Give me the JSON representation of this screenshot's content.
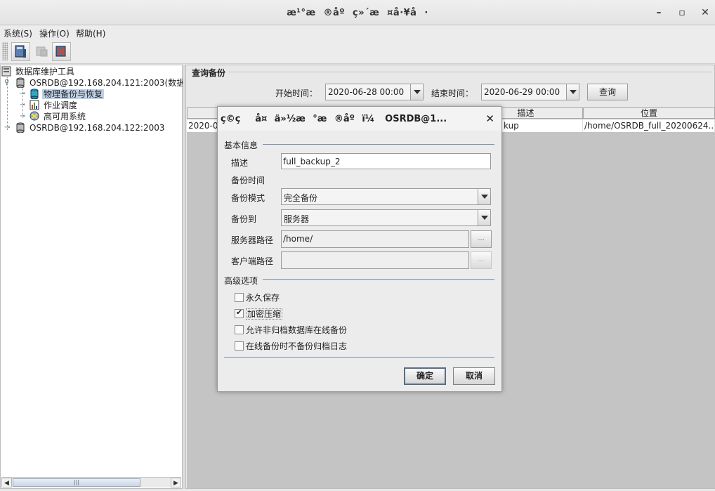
{
  "window": {
    "title": "æ¹°æ®åºç»´æ¤å·¥å·",
    "minimize": "–",
    "maximize": "▫",
    "close": "✕"
  },
  "menubar": [
    {
      "label": "系统(S)"
    },
    {
      "label": "操作(O)"
    },
    {
      "label": "帮助(H)"
    }
  ],
  "toolbar": {
    "buttons": [
      {
        "icon": "connect-icon",
        "enabled": true
      },
      {
        "icon": "disconnect-icon",
        "enabled": false
      },
      {
        "icon": "delete-connection-icon",
        "enabled": true
      }
    ]
  },
  "tree": {
    "root": "数据库维护工具",
    "nodes": [
      {
        "label": "OSRDB@192.168.204.121:2003(数据",
        "expanded": true
      },
      {
        "label": "物理备份与恢复",
        "selected": true
      },
      {
        "label": "作业调度"
      },
      {
        "label": "高可用系统"
      },
      {
        "label": "OSRDB@192.168.204.122:2003"
      }
    ]
  },
  "query": {
    "section_title": "查询备份",
    "start_label": "开始时间：",
    "start_value": "2020-06-28 00:00",
    "end_label": "结束时间：",
    "end_value": "2020-06-29 00:00",
    "query_button": "查询"
  },
  "table": {
    "columns": [
      "",
      "描述",
      "位置"
    ],
    "rows": [
      [
        "2020-0",
        "kup",
        "/home/OSRDB_full_20200624..."
      ]
    ]
  },
  "dialog": {
    "title": "ç©çå¤ä»½æ°æ®åºï¼ OSRDB@1...",
    "close": "✕",
    "basic_section": "基本信息",
    "desc_label": "描述",
    "desc_value": "full_backup_2",
    "backup_time_label": "备份时间",
    "mode_label": "备份模式",
    "mode_value": "完全备份",
    "target_label": "备份到",
    "target_value": "服务器",
    "server_path_label": "服务器路径",
    "server_path_value": "/home/",
    "client_path_label": "客户端路径",
    "client_path_value": "",
    "browse_label": "...",
    "advanced_section": "高级选项",
    "options": [
      {
        "label": "永久保存",
        "checked": false
      },
      {
        "label": "加密压缩",
        "checked": true
      },
      {
        "label": "允许非归档数据库在线备份",
        "checked": false
      },
      {
        "label": "在线备份时不备份归档日志",
        "checked": false
      }
    ],
    "ok_button": "确定",
    "cancel_button": "取消"
  }
}
